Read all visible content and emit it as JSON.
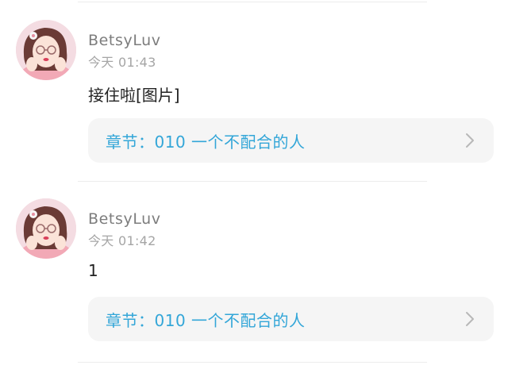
{
  "comments": [
    {
      "username": "BetsyLuv",
      "time": "今天 01:43",
      "content": "接住啦[图片]",
      "chapter": "章节：010 一个不配合的人",
      "avatar_icon": "avatar-girl-illustration"
    },
    {
      "username": "BetsyLuv",
      "time": "今天 01:42",
      "content": "1",
      "chapter": "章节：010 一个不配合的人",
      "avatar_icon": "avatar-girl-illustration"
    }
  ],
  "colors": {
    "chapter_text": "#33a6d8",
    "username": "#7d7d7d",
    "time": "#a5a5a5",
    "card_bg": "#f5f5f5"
  }
}
